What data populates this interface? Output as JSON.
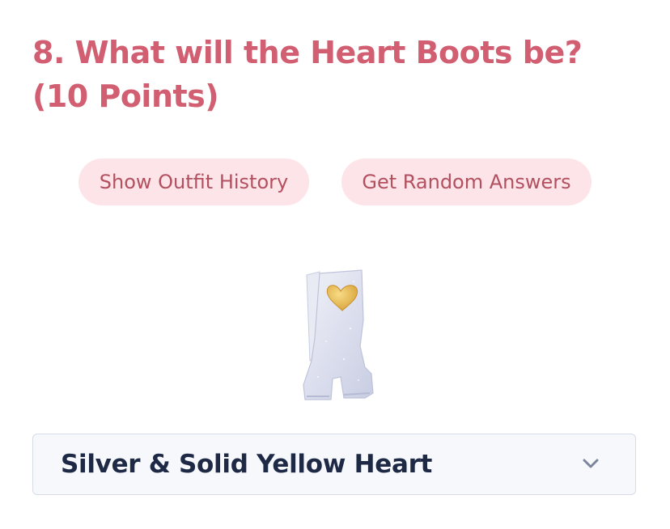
{
  "question": {
    "title": "8. What will the Heart Boots be? (10 Points)"
  },
  "actions": {
    "show_history_label": "Show Outfit History",
    "random_answers_label": "Get Random Answers"
  },
  "image": {
    "alt": "Heart Boots",
    "icon": "heart-boot-image",
    "colors": {
      "boot": "#e4e6f2",
      "heart": "#e9b84a"
    }
  },
  "answer": {
    "selected_value": "Silver & Solid Yellow Heart",
    "icon": "chevron-down-icon"
  },
  "colors": {
    "title": "#d25e72",
    "pill_bg": "#fde4e8",
    "pill_text": "#b3505f",
    "select_bg": "#f6f8fc",
    "select_border": "#d6dde8",
    "select_text": "#1e2a45"
  }
}
